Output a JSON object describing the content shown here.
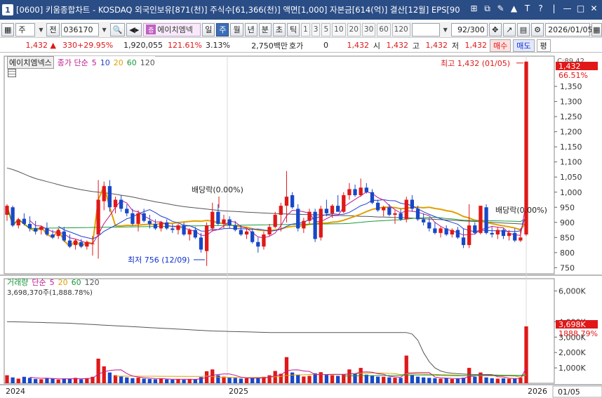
{
  "title": {
    "window_number": "1",
    "text": "[0600] 키움종합차트 - KOSDAQ 외국인보유[871(천)] 주식수[61,366(천)] 액면[1,000] 자본금[614(억)] 결산[12월] EPS[90",
    "window_buttons": [
      "⊞",
      "⧉",
      "✎",
      "▲",
      "T",
      "?",
      "|",
      "—",
      "□",
      "✕"
    ]
  },
  "toolbar": {
    "period_type": "주",
    "prev_label": "전",
    "code": "036170",
    "stock_name": "에이치엠넥",
    "stock_badge": "증",
    "period_tabs": [
      "일",
      "주",
      "월",
      "년",
      "분",
      "초",
      "틱"
    ],
    "selected_tab": "주",
    "intervals": [
      "1",
      "3",
      "5",
      "10",
      "20",
      "30",
      "60",
      "120"
    ],
    "count": "92/300",
    "date": "2026/01/05"
  },
  "quote": {
    "price": "1,432",
    "change": "330",
    "change_pct": "+29.95%",
    "volume": "1,920,055",
    "vol_ratio": "121.61%",
    "turnover": "3.13%",
    "amount": "2,750백만",
    "hoga_label": "호가",
    "hoga": "0",
    "ask": "1,432",
    "open_label": "시",
    "open": "1,432",
    "high_label": "고",
    "high": "1,432",
    "low_label": "저",
    "low": "1,432",
    "buy_label": "매수",
    "sell_label": "매도",
    "eval_label": "평"
  },
  "legend_price": {
    "name": "에이치엠넥스",
    "ma_label": "종가 단순",
    "ma_periods": [
      "5",
      "10",
      "20",
      "60",
      "120"
    ],
    "ma_colors": [
      "#c01890",
      "#2040d0",
      "#e0a000",
      "#1a9a3a",
      "#555555"
    ]
  },
  "legend_volume": {
    "name": "거래량",
    "ma_label": "단순",
    "ma_periods": [
      "5",
      "20",
      "60",
      "120"
    ],
    "ma_colors": [
      "#c01890",
      "#e0a000",
      "#1a9a3a",
      "#555555"
    ],
    "peak_label": "3,698,370주(1,888.78%)"
  },
  "annotations": {
    "high_marker": "최고 1,432 (01/05)",
    "low_marker": "최저 756 (12/09)",
    "dividend1": "배당락(0.00%)",
    "dividend2": "배당락(0.00%)"
  },
  "price_axis": {
    "ticks": [
      "1,350",
      "1,300",
      "1,250",
      "1,200",
      "1,150",
      "1,100",
      "1,050",
      "1,000",
      "950",
      "900",
      "850",
      "800",
      "750"
    ],
    "last_price_label": "1,432",
    "last_pct_label": "66.51%",
    "top_label": "C:89.42"
  },
  "volume_axis": {
    "ticks": [
      "6,000K",
      "4,000K",
      "3,000K",
      "2,000K",
      "1,000K"
    ],
    "last_label": "3,698K",
    "last_pct_label": "1888.79%"
  },
  "time_axis": {
    "labels": [
      "2024",
      "2025",
      "2026"
    ],
    "date_box": "01/05"
  },
  "chart_data": {
    "type": "candlestick",
    "period": "weekly",
    "ylim": [
      730,
      1450
    ],
    "volume_ylim": [
      0,
      6800
    ],
    "candles": [
      {
        "o": 925,
        "h": 960,
        "l": 905,
        "c": 955
      },
      {
        "o": 950,
        "h": 955,
        "l": 885,
        "c": 890
      },
      {
        "o": 890,
        "h": 915,
        "l": 880,
        "c": 910
      },
      {
        "o": 912,
        "h": 930,
        "l": 890,
        "c": 895
      },
      {
        "o": 895,
        "h": 920,
        "l": 870,
        "c": 880
      },
      {
        "o": 880,
        "h": 905,
        "l": 860,
        "c": 870
      },
      {
        "o": 875,
        "h": 890,
        "l": 860,
        "c": 885
      },
      {
        "o": 880,
        "h": 900,
        "l": 855,
        "c": 860
      },
      {
        "o": 860,
        "h": 875,
        "l": 845,
        "c": 850
      },
      {
        "o": 855,
        "h": 880,
        "l": 845,
        "c": 875
      },
      {
        "o": 870,
        "h": 885,
        "l": 835,
        "c": 840
      },
      {
        "o": 840,
        "h": 860,
        "l": 815,
        "c": 820
      },
      {
        "o": 825,
        "h": 845,
        "l": 810,
        "c": 840
      },
      {
        "o": 835,
        "h": 845,
        "l": 815,
        "c": 820
      },
      {
        "o": 820,
        "h": 840,
        "l": 810,
        "c": 835
      },
      {
        "o": 830,
        "h": 855,
        "l": 790,
        "c": 830
      },
      {
        "o": 860,
        "h": 1040,
        "l": 780,
        "c": 975
      },
      {
        "o": 970,
        "h": 1035,
        "l": 940,
        "c": 1020
      },
      {
        "o": 1020,
        "h": 1040,
        "l": 935,
        "c": 950
      },
      {
        "o": 950,
        "h": 985,
        "l": 930,
        "c": 975
      },
      {
        "o": 975,
        "h": 990,
        "l": 935,
        "c": 945
      },
      {
        "o": 945,
        "h": 960,
        "l": 920,
        "c": 930
      },
      {
        "o": 930,
        "h": 945,
        "l": 890,
        "c": 895
      },
      {
        "o": 895,
        "h": 940,
        "l": 870,
        "c": 930
      },
      {
        "o": 930,
        "h": 945,
        "l": 900,
        "c": 905
      },
      {
        "o": 905,
        "h": 925,
        "l": 880,
        "c": 895
      },
      {
        "o": 895,
        "h": 910,
        "l": 875,
        "c": 880
      },
      {
        "o": 880,
        "h": 905,
        "l": 870,
        "c": 900
      },
      {
        "o": 900,
        "h": 910,
        "l": 875,
        "c": 880
      },
      {
        "o": 880,
        "h": 895,
        "l": 865,
        "c": 875
      },
      {
        "o": 875,
        "h": 895,
        "l": 860,
        "c": 890
      },
      {
        "o": 890,
        "h": 900,
        "l": 855,
        "c": 860
      },
      {
        "o": 860,
        "h": 880,
        "l": 840,
        "c": 875
      },
      {
        "o": 875,
        "h": 885,
        "l": 845,
        "c": 850
      },
      {
        "o": 850,
        "h": 865,
        "l": 800,
        "c": 810
      },
      {
        "o": 805,
        "h": 900,
        "l": 756,
        "c": 890
      },
      {
        "o": 880,
        "h": 965,
        "l": 870,
        "c": 935
      },
      {
        "o": 935,
        "h": 960,
        "l": 890,
        "c": 895
      },
      {
        "o": 895,
        "h": 925,
        "l": 880,
        "c": 910
      },
      {
        "o": 910,
        "h": 920,
        "l": 880,
        "c": 890
      },
      {
        "o": 890,
        "h": 905,
        "l": 870,
        "c": 875
      },
      {
        "o": 875,
        "h": 890,
        "l": 855,
        "c": 860
      },
      {
        "o": 860,
        "h": 880,
        "l": 845,
        "c": 870
      },
      {
        "o": 870,
        "h": 880,
        "l": 830,
        "c": 835
      },
      {
        "o": 835,
        "h": 850,
        "l": 800,
        "c": 820
      },
      {
        "o": 820,
        "h": 870,
        "l": 810,
        "c": 860
      },
      {
        "o": 860,
        "h": 895,
        "l": 855,
        "c": 885
      },
      {
        "o": 885,
        "h": 935,
        "l": 880,
        "c": 925
      },
      {
        "o": 925,
        "h": 965,
        "l": 870,
        "c": 955
      },
      {
        "o": 955,
        "h": 1070,
        "l": 900,
        "c": 985
      },
      {
        "o": 990,
        "h": 1000,
        "l": 945,
        "c": 950
      },
      {
        "o": 945,
        "h": 960,
        "l": 870,
        "c": 880
      },
      {
        "o": 880,
        "h": 915,
        "l": 865,
        "c": 905
      },
      {
        "o": 905,
        "h": 945,
        "l": 895,
        "c": 935
      },
      {
        "o": 935,
        "h": 945,
        "l": 835,
        "c": 845
      },
      {
        "o": 850,
        "h": 955,
        "l": 840,
        "c": 945
      },
      {
        "o": 945,
        "h": 975,
        "l": 920,
        "c": 930
      },
      {
        "o": 930,
        "h": 960,
        "l": 915,
        "c": 955
      },
      {
        "o": 955,
        "h": 990,
        "l": 945,
        "c": 935
      },
      {
        "o": 935,
        "h": 1000,
        "l": 930,
        "c": 990
      },
      {
        "o": 990,
        "h": 1030,
        "l": 975,
        "c": 1010
      },
      {
        "o": 1010,
        "h": 1025,
        "l": 985,
        "c": 990
      },
      {
        "o": 990,
        "h": 1045,
        "l": 985,
        "c": 1015
      },
      {
        "o": 1015,
        "h": 1030,
        "l": 995,
        "c": 1000
      },
      {
        "o": 1000,
        "h": 1010,
        "l": 960,
        "c": 965
      },
      {
        "o": 965,
        "h": 975,
        "l": 935,
        "c": 940
      },
      {
        "o": 940,
        "h": 955,
        "l": 920,
        "c": 950
      },
      {
        "o": 950,
        "h": 960,
        "l": 920,
        "c": 925
      },
      {
        "o": 925,
        "h": 940,
        "l": 895,
        "c": 930
      },
      {
        "o": 930,
        "h": 945,
        "l": 905,
        "c": 910
      },
      {
        "o": 910,
        "h": 985,
        "l": 900,
        "c": 975
      },
      {
        "o": 975,
        "h": 990,
        "l": 935,
        "c": 945
      },
      {
        "o": 945,
        "h": 955,
        "l": 905,
        "c": 910
      },
      {
        "o": 910,
        "h": 930,
        "l": 890,
        "c": 900
      },
      {
        "o": 900,
        "h": 915,
        "l": 870,
        "c": 880
      },
      {
        "o": 880,
        "h": 900,
        "l": 860,
        "c": 865
      },
      {
        "o": 865,
        "h": 885,
        "l": 850,
        "c": 880
      },
      {
        "o": 880,
        "h": 890,
        "l": 855,
        "c": 860
      },
      {
        "o": 860,
        "h": 880,
        "l": 850,
        "c": 875
      },
      {
        "o": 875,
        "h": 885,
        "l": 845,
        "c": 850
      },
      {
        "o": 850,
        "h": 880,
        "l": 815,
        "c": 825
      },
      {
        "o": 825,
        "h": 960,
        "l": 815,
        "c": 890
      },
      {
        "o": 890,
        "h": 900,
        "l": 860,
        "c": 865
      },
      {
        "o": 865,
        "h": 955,
        "l": 860,
        "c": 955
      },
      {
        "o": 950,
        "h": 960,
        "l": 860,
        "c": 865
      },
      {
        "o": 865,
        "h": 885,
        "l": 850,
        "c": 860
      },
      {
        "o": 860,
        "h": 885,
        "l": 845,
        "c": 875
      },
      {
        "o": 875,
        "h": 880,
        "l": 845,
        "c": 855
      },
      {
        "o": 855,
        "h": 875,
        "l": 840,
        "c": 865
      },
      {
        "o": 865,
        "h": 880,
        "l": 835,
        "c": 840
      },
      {
        "o": 840,
        "h": 880,
        "l": 835,
        "c": 850
      },
      {
        "o": 860,
        "h": 1432,
        "l": 855,
        "c": 1432
      }
    ],
    "volume": [
      520,
      380,
      300,
      420,
      350,
      280,
      260,
      330,
      300,
      240,
      310,
      290,
      350,
      260,
      330,
      420,
      1600,
      1100,
      700,
      520,
      440,
      380,
      330,
      360,
      300,
      280,
      260,
      300,
      250,
      240,
      270,
      230,
      280,
      250,
      400,
      780,
      900,
      520,
      430,
      380,
      350,
      300,
      330,
      320,
      380,
      420,
      520,
      800,
      620,
      1700,
      700,
      540,
      440,
      480,
      650,
      720,
      560,
      520,
      480,
      600,
      900,
      640,
      1000,
      560,
      480,
      430,
      420,
      380,
      360,
      350,
      1800,
      520,
      430,
      380,
      350,
      330,
      300,
      320,
      280,
      300,
      360,
      1000,
      420,
      700,
      380,
      330,
      300,
      320,
      290,
      300,
      360,
      3698
    ],
    "ma120_price": [
      1080,
      1075,
      1068,
      1060,
      1052,
      1045,
      1040,
      1035,
      1030,
      1025,
      1020,
      1016,
      1012,
      1008,
      1005,
      1002,
      1000,
      998,
      996,
      993,
      990,
      987,
      984,
      980,
      976,
      972,
      968,
      965,
      962,
      958,
      955,
      952,
      950,
      948,
      946,
      944,
      942,
      940,
      938,
      937,
      936,
      935,
      934,
      933,
      932,
      931,
      930,
      929,
      928,
      928,
      927,
      927,
      926,
      926,
      925,
      925,
      924,
      924,
      923,
      922,
      922,
      921,
      920,
      920,
      919,
      918,
      918,
      917,
      916,
      916,
      915,
      914,
      913,
      912,
      911,
      910,
      909,
      908,
      907,
      906,
      905,
      904,
      903,
      902,
      901,
      900,
      899,
      898,
      897,
      896,
      895,
      894
    ],
    "ma120_volume": [
      4000,
      4000,
      3990,
      3980,
      3970,
      3960,
      3950,
      3940,
      3930,
      3920,
      3910,
      3900,
      3880,
      3860,
      3840,
      3820,
      3800,
      3780,
      3760,
      3740,
      3720,
      3700,
      3680,
      3660,
      3640,
      3620,
      3600,
      3580,
      3560,
      3540,
      3520,
      3500,
      3480,
      3460,
      3440,
      3420,
      3400,
      3390,
      3380,
      3370,
      3360,
      3350,
      3340,
      3330,
      3320,
      3310,
      3300,
      3300,
      3300,
      3300,
      3300,
      3300,
      3300,
      3300,
      3300,
      3300,
      3300,
      3300,
      3300,
      3300,
      3300,
      3300,
      3300,
      3300,
      3300,
      3300,
      3300,
      3300,
      3300,
      3300,
      3300,
      3200,
      2800,
      2000,
      1400,
      1000,
      800,
      700,
      650,
      620,
      600,
      580,
      570,
      560,
      550,
      540,
      530,
      520,
      510,
      500,
      500,
      500
    ]
  }
}
